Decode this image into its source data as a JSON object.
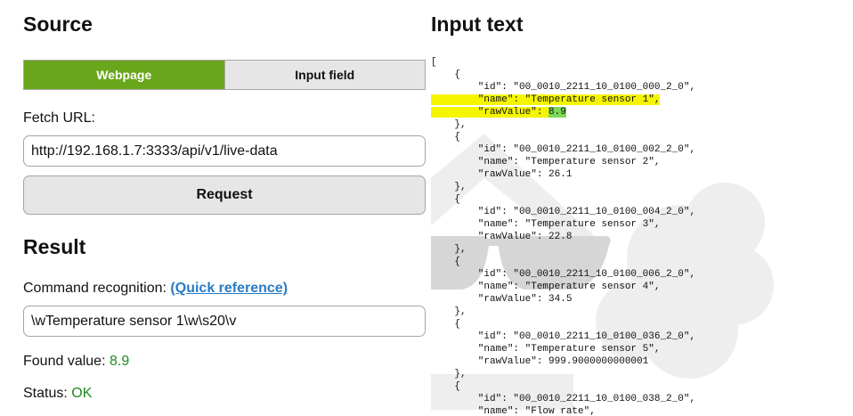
{
  "source": {
    "title": "Source",
    "tabs": [
      {
        "label": "Webpage",
        "active": true
      },
      {
        "label": "Input field",
        "active": false
      }
    ],
    "fetch_label": "Fetch URL:",
    "fetch_url": "http://192.168.1.7:3333/api/v1/live-data",
    "request_label": "Request"
  },
  "result": {
    "title": "Result",
    "command_label": "Command recognition:",
    "quick_reference": "(Quick reference)",
    "command_value": "\\wTemperature sensor 1\\w\\s20\\v",
    "found_label": "Found value:",
    "found_value": "8.9",
    "status_label": "Status:",
    "status_value": "OK"
  },
  "input_text": {
    "title": "Input text",
    "json_lines": [
      "[",
      "    {",
      "        \"id\": \"00_0010_2211_10_0100_000_2_0\",",
      "        \"name\": \"Temperature sensor 1\",",
      "        \"rawValue\": 8.9",
      "    },",
      "    {",
      "        \"id\": \"00_0010_2211_10_0100_002_2_0\",",
      "        \"name\": \"Temperature sensor 2\",",
      "        \"rawValue\": 26.1",
      "    },",
      "    {",
      "        \"id\": \"00_0010_2211_10_0100_004_2_0\",",
      "        \"name\": \"Temperature sensor 3\",",
      "        \"rawValue\": 22.8",
      "    },",
      "    {",
      "        \"id\": \"00_0010_2211_10_0100_006_2_0\",",
      "        \"name\": \"Temperature sensor 4\",",
      "        \"rawValue\": 34.5",
      "    },",
      "    {",
      "        \"id\": \"00_0010_2211_10_0100_036_2_0\",",
      "        \"name\": \"Temperature sensor 5\",",
      "        \"rawValue\": 999.9000000000001",
      "    },",
      "    {",
      "        \"id\": \"00_0010_2211_10_0100_038_2_0\",",
      "        \"name\": \"Flow rate\","
    ],
    "highlight": {
      "name_line": 3,
      "value_line": 4,
      "value": "8.9"
    }
  },
  "colors": {
    "accent": "#6aa61b",
    "link": "#2a7bc5",
    "ok": "#1f8a1f",
    "match_highlight": "#f5f500",
    "value_highlight": "#7ed957"
  }
}
